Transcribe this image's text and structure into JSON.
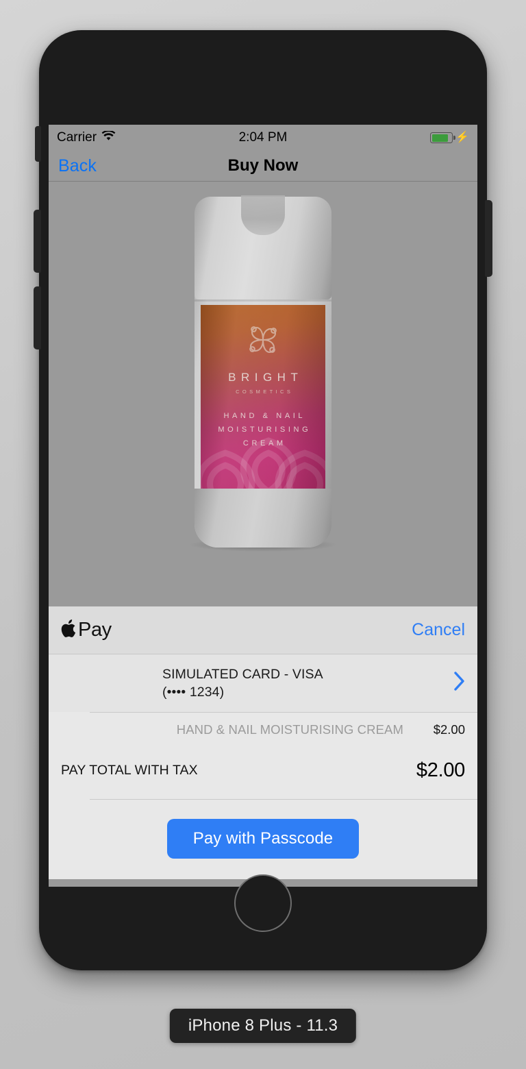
{
  "status_bar": {
    "carrier": "Carrier",
    "wifi_icon": "wifi-icon",
    "time": "2:04 PM",
    "battery_icon": "battery-icon",
    "charging_icon": "lightning-bolt-icon",
    "battery_level_percent": 82
  },
  "nav_bar": {
    "back_label": "Back",
    "title": "Buy Now"
  },
  "product": {
    "brand": "BRIGHT",
    "brand_sub": "COSMETICS",
    "desc_line1": "HAND & NAIL",
    "desc_line2": "MOISTURISING",
    "desc_line3": "CREAM",
    "logo_icon": "clover-emblem-icon"
  },
  "pay_sheet": {
    "apple_glyph": "",
    "apple_pay_word": "Pay",
    "cancel_label": "Cancel",
    "card": {
      "name": "SIMULATED CARD - VISA",
      "number": "(•••• 1234)",
      "chevron_icon": "chevron-right-icon"
    },
    "summary": {
      "item_label": "HAND & NAIL MOISTURISING CREAM",
      "item_amount": "$2.00",
      "total_label": "PAY TOTAL WITH TAX",
      "total_amount": "$2.00"
    },
    "pay_button_label": "Pay with Passcode"
  },
  "device_caption": "iPhone 8 Plus - 11.3",
  "colors": {
    "accent_blue": "#2f7ef5",
    "link_blue": "#0a72f5",
    "battery_green": "#3c9c3c",
    "sheet_bg": "#e8e8e8",
    "screen_bg": "#9a9a9a"
  }
}
